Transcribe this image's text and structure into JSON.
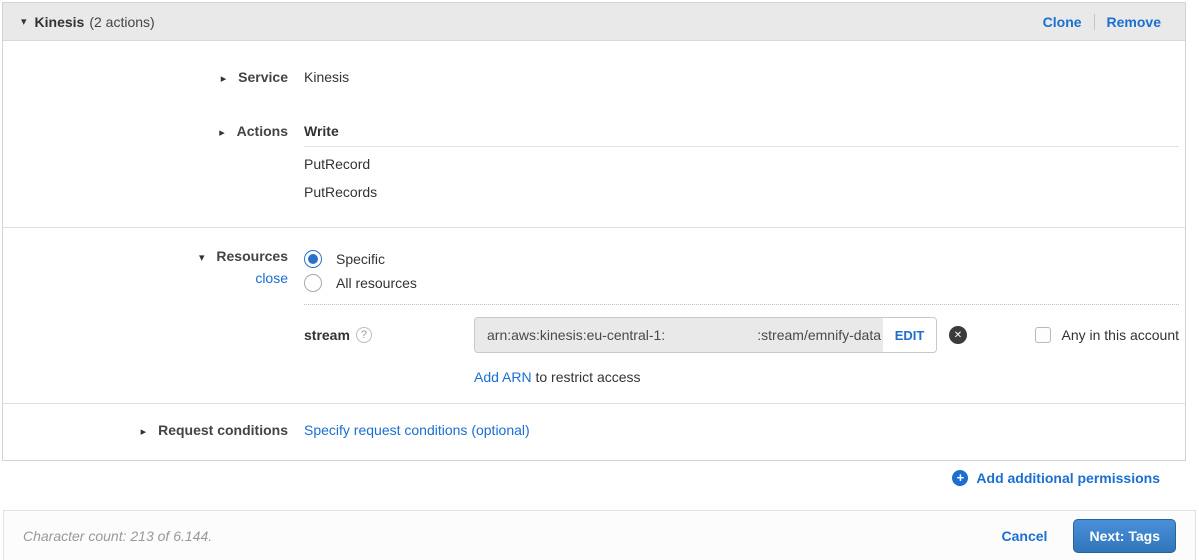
{
  "colors": {
    "link_blue": "#1a6fd1",
    "radio_selected_blue": "#2a72c8",
    "button_gradient_top": "#4a90d9",
    "button_gradient_bottom": "#2f76bb",
    "header_bar_gray": "#e9e9e9"
  },
  "icons": {
    "caret_down": "▾",
    "caret_right": "▸",
    "help": "?",
    "remove_circle": "✕",
    "plus": "+"
  },
  "header": {
    "title": "Kinesis",
    "count": "(2 actions)",
    "clone_label": "Clone",
    "remove_label": "Remove"
  },
  "service": {
    "label": "Service",
    "value": "Kinesis"
  },
  "actions": {
    "label": "Actions",
    "group_header": "Write",
    "items": [
      "PutRecord",
      "PutRecords"
    ]
  },
  "resources": {
    "label": "Resources",
    "close_label": "close",
    "options": [
      {
        "label": "Specific",
        "selected": true
      },
      {
        "label": "All resources",
        "selected": false
      }
    ],
    "stream": {
      "label": "stream",
      "arn_prefix": "arn:aws:kinesis:eu-central-1:",
      "arn_suffix": ":stream/emnify-data",
      "edit_label": "EDIT",
      "any_account_label": "Any in this account"
    },
    "add_arn": {
      "link_text": "Add ARN",
      "suffix_text": " to restrict access"
    }
  },
  "request_conditions": {
    "label": "Request conditions",
    "link_label": "Specify request conditions (optional)"
  },
  "add_permissions": {
    "label": "Add additional permissions"
  },
  "footer": {
    "character_count": "Character count: 213 of 6.144.",
    "cancel_label": "Cancel",
    "next_label": "Next: Tags"
  }
}
